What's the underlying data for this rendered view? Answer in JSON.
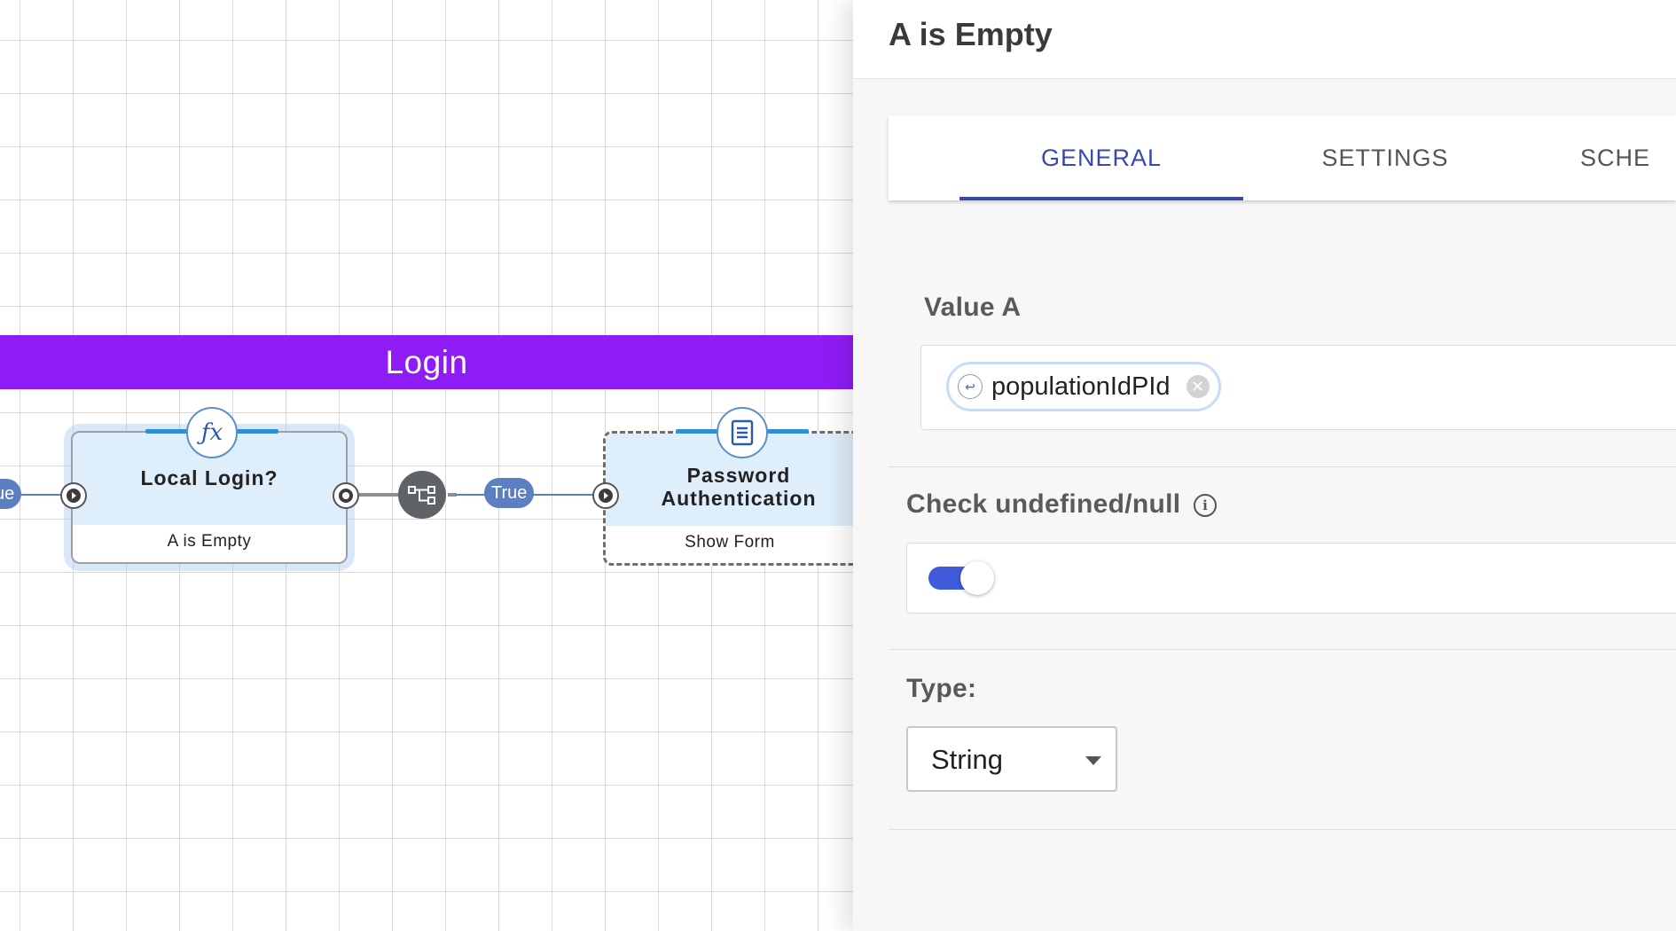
{
  "canvas": {
    "section_title": "Login",
    "incoming_edge_label": "ue",
    "true_edge_label": "True",
    "nodes": [
      {
        "title": "Local Login?",
        "subtitle": "A is Empty",
        "icon": "function-icon"
      },
      {
        "title": "Password Authentication",
        "subtitle": "Show Form",
        "icon": "form-icon"
      }
    ]
  },
  "panel": {
    "title": "A is Empty",
    "tabs": [
      {
        "label": "GENERAL",
        "active": true
      },
      {
        "label": "SETTINGS",
        "active": false
      },
      {
        "label": "SCHE",
        "active": false
      }
    ],
    "value_a": {
      "label": "Value A",
      "chip_text": "populationIdPId"
    },
    "check_undefined": {
      "label": "Check undefined/null",
      "enabled": true
    },
    "type": {
      "label": "Type:",
      "selected": "String"
    }
  },
  "colors": {
    "banner": "#8e1cf5",
    "accent": "#3949ab",
    "toggle_on": "#3f5bd9",
    "edge_label": "#5b7fc0"
  }
}
